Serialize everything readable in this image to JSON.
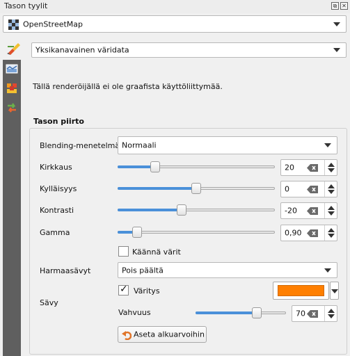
{
  "panel": {
    "title": "Tason tyylit",
    "float_icon": "float-icon",
    "close_icon": "close-icon"
  },
  "layer_selector": {
    "value": "OpenStreetMap",
    "icon": "osm-layer-icon"
  },
  "renderer": {
    "value": "Yksikanavainen väridata",
    "icon": "paintbrush-icon"
  },
  "sidebar": {
    "items": [
      {
        "icon": "symbology-icon"
      },
      {
        "icon": "layer-stack-icon"
      },
      {
        "icon": "history-icon"
      }
    ]
  },
  "message": "Tällä renderöijällä ei ole graafista käyttöliittymää.",
  "layer_rendering": {
    "title": "Tason piirto",
    "blending": {
      "label": "Blending-menetelmä",
      "value": "Normaali"
    },
    "brightness": {
      "label": "Kirkkaus",
      "value": "20",
      "fraction": 0.22
    },
    "saturation": {
      "label": "Kylläisyys",
      "value": "0",
      "fraction": 0.5
    },
    "contrast": {
      "label": "Kontrasti",
      "value": "-20",
      "fraction": 0.4
    },
    "gamma": {
      "label": "Gamma",
      "value": "0,90",
      "fraction": 0.1
    },
    "invert_colors": {
      "label": "Käännä värit",
      "checked": false
    },
    "grayscale": {
      "label": "Harmaasävyt",
      "value": "Pois päältä"
    },
    "hue": {
      "label": "Sävy",
      "colorize": {
        "label": "Väritys",
        "checked": true
      },
      "color": "#ff7f00",
      "strength": {
        "label": "Vahvuus",
        "value": "70",
        "fraction": 0.7
      }
    },
    "reset_button": "Aseta alkuarvoihin"
  },
  "colors": {
    "accent": "#4a90d9",
    "sidebar": "#5f5f5f"
  }
}
